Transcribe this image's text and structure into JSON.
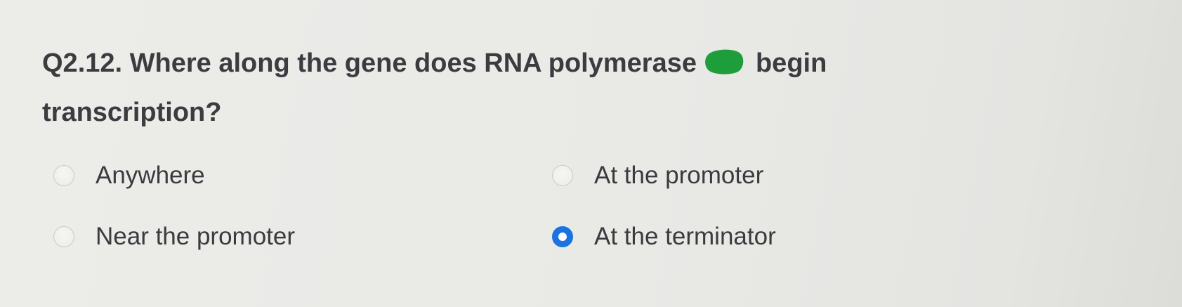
{
  "question": {
    "text_before": "Q2.12. Where along the gene does RNA polymerase",
    "text_after": "begin transcription?",
    "icon": "green-blob-icon",
    "icon_color": "#1e9e3a"
  },
  "options": [
    {
      "label": "Anywhere",
      "selected": false
    },
    {
      "label": "At the promoter",
      "selected": false
    },
    {
      "label": "Near the promoter",
      "selected": false
    },
    {
      "label": "At the terminator",
      "selected": true
    }
  ],
  "colors": {
    "radio_selected": "#1b73e0",
    "text": "#3a3b3e",
    "background": "#ebebe8"
  }
}
